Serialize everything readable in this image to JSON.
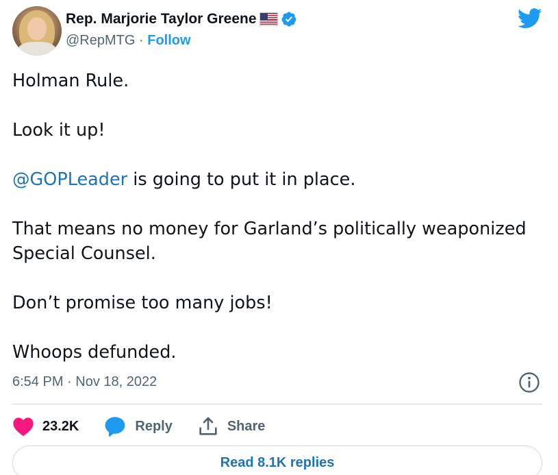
{
  "author": {
    "display_name": "Rep. Marjorie Taylor Greene",
    "handle": "@RepMTG",
    "separator": "·",
    "follow_label": "Follow",
    "flag_icon": "us-flag-icon",
    "verified_icon": "verified-badge-icon"
  },
  "tweet": {
    "paragraphs": [
      {
        "text": "Holman Rule."
      },
      {
        "text": "Look it up!"
      },
      {
        "mention": "@GOPLeader",
        "text": " is going to put it in place."
      },
      {
        "text": "That means no money for Garland’s politically weaponized Special Counsel."
      },
      {
        "text": "Don’t promise too many jobs!"
      },
      {
        "text": "Whoops defunded."
      }
    ],
    "timestamp": "6:54 PM · Nov 18, 2022"
  },
  "actions": {
    "like_count": "23.2K",
    "reply_label": "Reply",
    "share_label": "Share"
  },
  "footer": {
    "read_replies_label": "Read 8.1K replies"
  },
  "colors": {
    "accent": "#1d9bf0",
    "mention": "#1d73b8",
    "like": "#f91880",
    "reply": "#1d9bf0",
    "secondary_text": "#536471"
  }
}
